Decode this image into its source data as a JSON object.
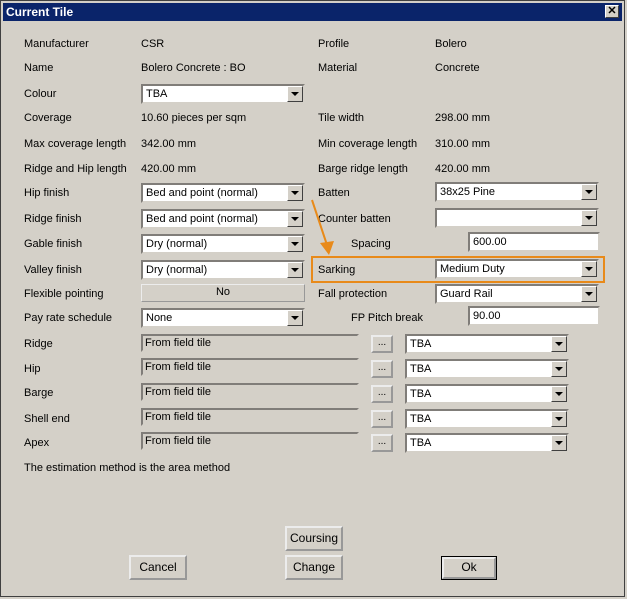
{
  "window": {
    "title": "Current Tile",
    "close_glyph": "✕"
  },
  "left": {
    "manufacturer": {
      "label": "Manufacturer",
      "value": "CSR"
    },
    "name": {
      "label": "Name",
      "value": "Bolero Concrete : BO"
    },
    "colour": {
      "label": "Colour",
      "value": "TBA"
    },
    "coverage": {
      "label": "Coverage",
      "value": "10.60 pieces per sqm"
    },
    "max_coverage_length": {
      "label": "Max coverage length",
      "value": "342.00 mm"
    },
    "ridge_hip_length": {
      "label": "Ridge and Hip length",
      "value": "420.00 mm"
    },
    "hip_finish": {
      "label": "Hip finish",
      "value": "Bed and point (normal)"
    },
    "ridge_finish": {
      "label": "Ridge finish",
      "value": "Bed and point (normal)"
    },
    "gable_finish": {
      "label": "Gable finish",
      "value": "Dry (normal)"
    },
    "valley_finish": {
      "label": "Valley  finish",
      "value": "Dry (normal)"
    },
    "flexible_pointing": {
      "label": "Flexible pointing",
      "value": "No"
    },
    "pay_rate_schedule": {
      "label": "Pay rate schedule",
      "value": "None"
    }
  },
  "right": {
    "profile": {
      "label": "Profile",
      "value": "Bolero"
    },
    "material": {
      "label": "Material",
      "value": "Concrete"
    },
    "tile_width": {
      "label": "Tile width",
      "value": "298.00 mm"
    },
    "min_coverage_length": {
      "label": "Min coverage length",
      "value": "310.00 mm"
    },
    "barge_ridge_length": {
      "label": "Barge ridge length",
      "value": "420.00 mm"
    },
    "batten": {
      "label": "Batten",
      "value": "38x25 Pine"
    },
    "counter_batten": {
      "label": "Counter batten",
      "value": ""
    },
    "spacing": {
      "label": "Spacing",
      "value": "600.00"
    },
    "sarking": {
      "label": "Sarking",
      "value": "Medium Duty"
    },
    "fall_protection": {
      "label": "Fall protection",
      "value": "Guard Rail"
    },
    "fp_pitch_break": {
      "label": "FP Pitch break",
      "value": "90.00"
    }
  },
  "accessories": [
    {
      "label": "Ridge",
      "source": "From field tile",
      "option": "TBA"
    },
    {
      "label": "Hip",
      "source": "From field tile",
      "option": "TBA"
    },
    {
      "label": "Barge",
      "source": "From field tile",
      "option": "TBA"
    },
    {
      "label": "Shell end",
      "source": "From field tile",
      "option": "TBA"
    },
    {
      "label": "Apex",
      "source": "From field tile",
      "option": "TBA"
    }
  ],
  "browse_label": "...",
  "estimation_note": "The estimation method is the area method",
  "buttons": {
    "coursing": "Coursing",
    "cancel": "Cancel",
    "change": "Change",
    "ok": "Ok"
  },
  "annotation": {
    "highlight_color": "#e88a1a",
    "arrow_color": "#e88a1a"
  }
}
